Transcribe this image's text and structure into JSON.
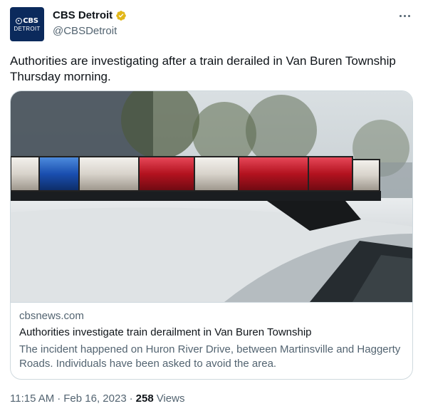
{
  "author": {
    "display_name": "CBS Detroit",
    "handle": "@CBSDetroit",
    "avatar_logo_top": "CBS",
    "avatar_logo_bottom": "DETROIT",
    "verified_badge_color": "#e2b719",
    "avatar_color": "#0b2a5c"
  },
  "tweet": {
    "text": "Authorities are investigating after a train derailed in Van Buren Township Thursday morning."
  },
  "card": {
    "image_subject": "police-car-light-bar",
    "domain": "cbsnews.com",
    "title": "Authorities investigate train derailment in Van Buren Township",
    "description": "The incident happened on Huron River Drive, between Martinsville and Haggerty Roads. Individuals have been asked to avoid the area."
  },
  "footer": {
    "time": "11:15 AM",
    "separator": "·",
    "date": "Feb 16, 2023",
    "views_count": "258",
    "views_label": "Views"
  },
  "colors": {
    "text_primary": "#0f1419",
    "text_secondary": "#536471",
    "border": "#cfd9de"
  }
}
